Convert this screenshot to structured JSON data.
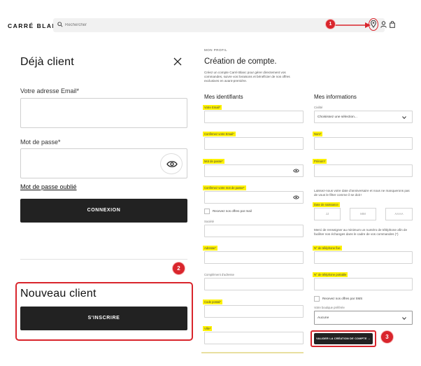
{
  "header": {
    "logo": "CARRÉ BLANC",
    "search_placeholder": "Rechercher"
  },
  "markers": [
    "1",
    "2",
    "3"
  ],
  "login": {
    "title": "Déjà client",
    "email_label": "Votre adresse Email*",
    "password_label": "Mot de passe*",
    "forgot_link": "Mot de passe oublié",
    "submit": "CONNEXION"
  },
  "signup_cta": {
    "title": "Nouveau client",
    "button": "S'INSCRIRE"
  },
  "register": {
    "breadcrumb": "MON PROFIL",
    "title": "Création de compte.",
    "intro": "Créez un compte Carré Blanc pour gérer directement vos commandes, suivre vos livraisons et bénéficier de nos offres exclusives en avant-première.",
    "left_section": "Mes identifiants",
    "right_section": "Mes informations",
    "fields_left": {
      "email": "Votre Email*",
      "email_confirm": "Confirmez votre Email*",
      "password": "Mot de passe*",
      "password_confirm": "Confirmez votre mot de passe*",
      "newsletter": "Recevez nos offres par mail",
      "company": "Société",
      "address": "Adresse*",
      "address_more": "Complément d'adresse",
      "zip": "Code postal*",
      "city": "Ville*"
    },
    "fields_right": {
      "civility_label": "Civilité",
      "civility_value": "Choisissez une sélection...",
      "lastname": "Nom*",
      "firstname": "Prénom*",
      "birthday_text": "Laissez-nous votre date d'anniversaire et nous ne manquerons pas de vous le fêter comme il se doit !",
      "birthday_label": "Date de naissance",
      "day": "JJ",
      "month": "MM",
      "year": "AAAA",
      "phone_text": "Merci de renseigner au minimum un numéro de téléphone afin de faciliter nos échanges dans le cadre de vos commandes (*)",
      "phone_fixed": "N° de téléphone fixe",
      "phone_mobile": "N° de téléphone portable",
      "sms": "Recevez nos offres par SMS",
      "store_label": "Votre boutique préférée",
      "store_value": "Aucune",
      "submit": "VALIDER LA CRÉATION DE COMPTE →"
    }
  },
  "colors": {
    "accent_red": "#d9252c",
    "highlight": "#fff200",
    "dark_button": "#222222"
  }
}
